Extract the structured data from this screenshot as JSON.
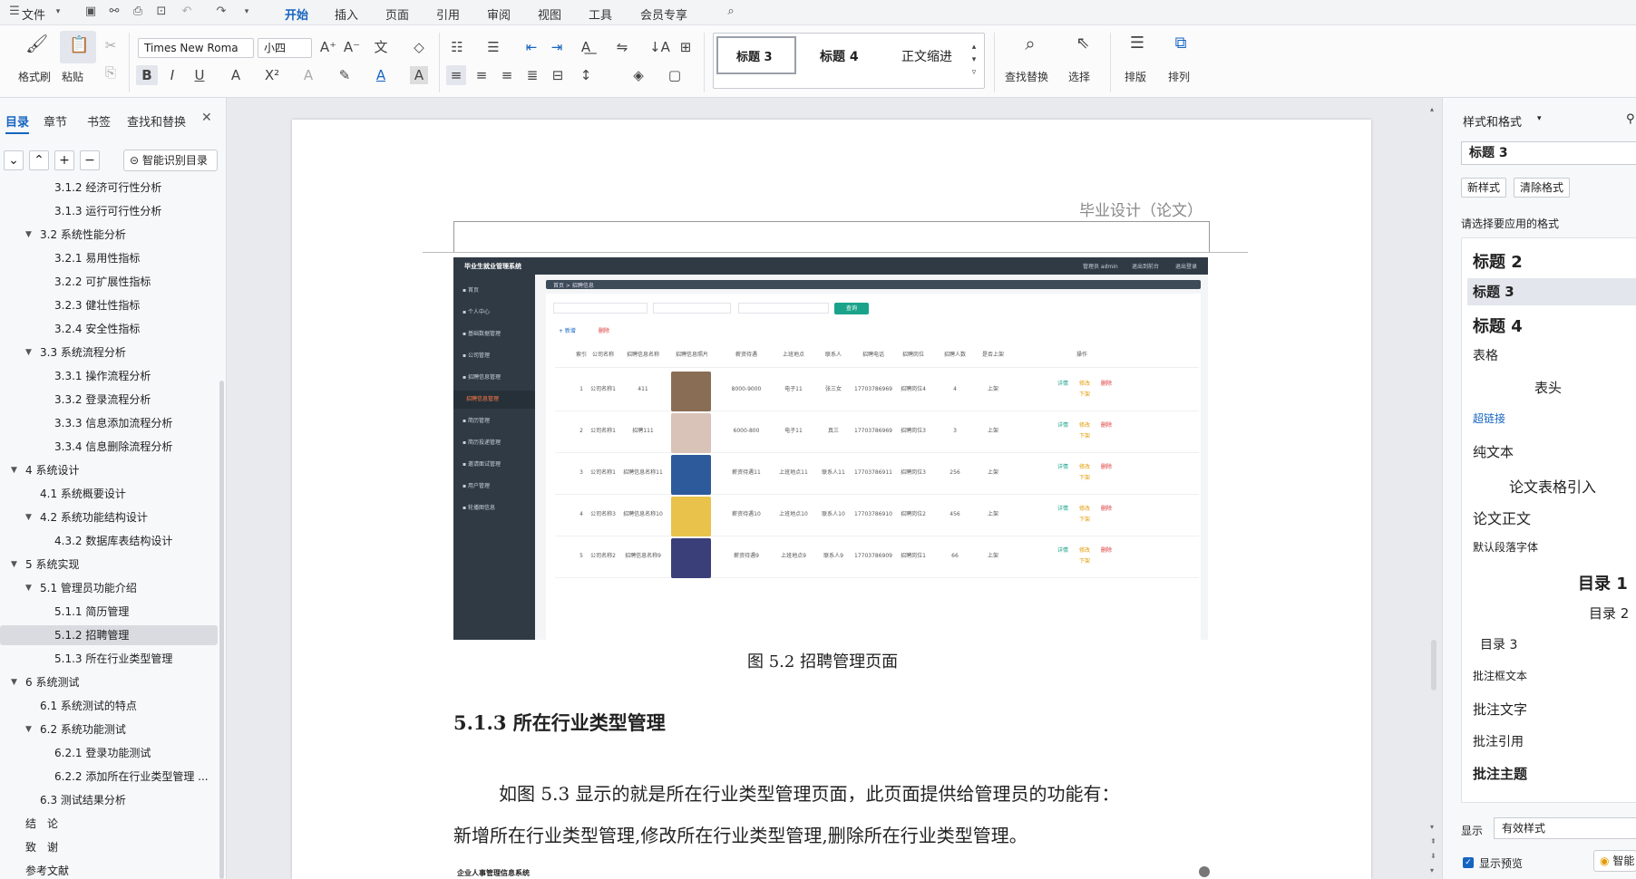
{
  "menubar": {
    "file": "文件",
    "tabs": [
      "开始",
      "插入",
      "页面",
      "引用",
      "审阅",
      "视图",
      "工具",
      "会员专享"
    ],
    "active_tab": "开始"
  },
  "ribbon": {
    "format_painter": "格式刷",
    "paste": "粘贴",
    "font_name": "Times New Roma",
    "font_size": "小四",
    "styles": [
      "标题 3",
      "标题 4",
      "正文缩进"
    ],
    "find_replace": "查找替换",
    "select": "选择",
    "layout": "排版",
    "arrange": "排列"
  },
  "leftpanel": {
    "tabs": [
      "目录",
      "章节",
      "书签",
      "查找和替换"
    ],
    "smart_toc": "智能识别目录",
    "toc": [
      {
        "num": "3.1.2",
        "text": "经济可行性分析",
        "level": 3
      },
      {
        "num": "3.1.3",
        "text": "运行可行性分析",
        "level": 3
      },
      {
        "num": "3.2",
        "text": "系统性能分析",
        "level": 2
      },
      {
        "num": "3.2.1",
        "text": "易用性指标",
        "level": 3
      },
      {
        "num": "3.2.2",
        "text": "可扩展性指标",
        "level": 3
      },
      {
        "num": "3.2.3",
        "text": "健壮性指标",
        "level": 3
      },
      {
        "num": "3.2.4",
        "text": "安全性指标",
        "level": 3
      },
      {
        "num": "3.3",
        "text": "系统流程分析",
        "level": 2
      },
      {
        "num": "3.3.1",
        "text": "操作流程分析",
        "level": 3
      },
      {
        "num": "3.3.2",
        "text": "登录流程分析",
        "level": 3
      },
      {
        "num": "3.3.3",
        "text": "信息添加流程分析",
        "level": 3
      },
      {
        "num": "3.3.4",
        "text": "信息删除流程分析",
        "level": 3
      },
      {
        "num": "4",
        "text": "系统设计",
        "level": 1
      },
      {
        "num": "4.1",
        "text": "系统概要设计",
        "level": 2
      },
      {
        "num": "4.2",
        "text": "系统功能结构设计",
        "level": 2
      },
      {
        "num": "4.3.2",
        "text": "数据库表结构设计",
        "level": 3
      },
      {
        "num": "5",
        "text": "系统实现",
        "level": 1
      },
      {
        "num": "5.1",
        "text": "管理员功能介绍",
        "level": 2
      },
      {
        "num": "5.1.1",
        "text": "简历管理",
        "level": 3
      },
      {
        "num": "5.1.2",
        "text": "招聘管理",
        "level": 3
      },
      {
        "num": "5.1.3",
        "text": "所在行业类型管理",
        "level": 3
      },
      {
        "num": "6",
        "text": "系统测试",
        "level": 1
      },
      {
        "num": "6.1",
        "text": "系统测试的特点",
        "level": 2
      },
      {
        "num": "6.2",
        "text": "系统功能测试",
        "level": 2
      },
      {
        "num": "6.2.1",
        "text": "登录功能测试",
        "level": 3
      },
      {
        "num": "6.2.2",
        "text": "添加所在行业类型管理 ...",
        "level": 3
      },
      {
        "num": "6.3",
        "text": "测试结果分析",
        "level": 2
      },
      {
        "num": "",
        "text": "结　论",
        "level": 1
      },
      {
        "num": "",
        "text": "致　谢",
        "level": 1
      },
      {
        "num": "",
        "text": "参考文献",
        "level": 1
      }
    ]
  },
  "document": {
    "header_text": "毕业设计（论文）",
    "figure_caption": "图 5.2  招聘管理页面",
    "section_heading": "5.1.3  所在行业类型管理",
    "para_line1": "如图 5.3 显示的就是所在行业类型管理页面，此页面提供给管理员的功能有：",
    "para_line2": "新增所在行业类型管理,修改所在行业类型管理,删除所在行业类型管理。",
    "next_fig_title": "企业人事管理信息系统"
  },
  "screenshot": {
    "app_title": "毕业生就业管理系统",
    "top_right": [
      "管理员 admin",
      "退出到前台",
      "退出登录"
    ],
    "breadcrumb": "首页 > 招聘信息",
    "sidebar": [
      "首页",
      "个人中心",
      "基础数据管理",
      "公司管理",
      "招聘信息管理",
      "招聘信息管理",
      "简历管理",
      "简历投递管理",
      "邀请面试管理",
      "用户管理",
      "轮播图信息"
    ],
    "search_btn": "查询",
    "add_btn": "+ 新增",
    "del_btn": "删除",
    "headers": [
      "索引",
      "公司名称",
      "招聘信息名称",
      "招聘信息照片",
      "薪资待遇",
      "上班地点",
      "联系人",
      "招聘电话",
      "招聘岗位",
      "招聘人数",
      "是否上架",
      "操作"
    ],
    "rows": [
      [
        "1",
        "公司名称1",
        "411",
        "",
        "8000-9000",
        "电子11",
        "张三女",
        "17703786969",
        "招聘岗位4",
        "4",
        "上架"
      ],
      [
        "2",
        "公司名称1",
        "招聘111",
        "",
        "6000-800",
        "电子11",
        "真三",
        "17703786969",
        "招聘岗位3",
        "3",
        "上架"
      ],
      [
        "3",
        "公司名称1",
        "招聘信息名称11",
        "",
        "薪资待遇11",
        "上班地点11",
        "联系人11",
        "17703786911",
        "招聘岗位3",
        "256",
        "上架"
      ],
      [
        "4",
        "公司名称3",
        "招聘信息名称10",
        "",
        "薪资待遇10",
        "上班地点10",
        "联系人10",
        "17703786910",
        "招聘岗位2",
        "456",
        "上架"
      ],
      [
        "5",
        "公司名称2",
        "招聘信息名称9",
        "",
        "薪资待遇9",
        "上班地点9",
        "联系人9",
        "17703786909",
        "招聘岗位1",
        "66",
        "上架"
      ]
    ],
    "actions": [
      "详情",
      "修改",
      "删除",
      "下架"
    ]
  },
  "rightpanel": {
    "title": "样式和格式",
    "current_style": "标题 3",
    "new_style": "新样式",
    "clear_format": "清除格式",
    "apply_label": "请选择要应用的格式",
    "styles": [
      "标题 2",
      "标题 3",
      "标题 4",
      "表格",
      "表头",
      "超链接",
      "纯文本",
      "论文表格引入",
      "论文正文",
      "默认段落字体",
      "目录 1",
      "目录 2",
      "目录 3",
      "批注框文本",
      "批注文字",
      "批注引用",
      "批注主题"
    ],
    "show_label": "显示",
    "show_value": "有效样式",
    "preview_label": "显示预览",
    "smart": "智能"
  },
  "colors": {
    "accent": "#1565c0",
    "selected_row": "#d9dbe0",
    "sidebar_dark": "#2f3a45"
  }
}
